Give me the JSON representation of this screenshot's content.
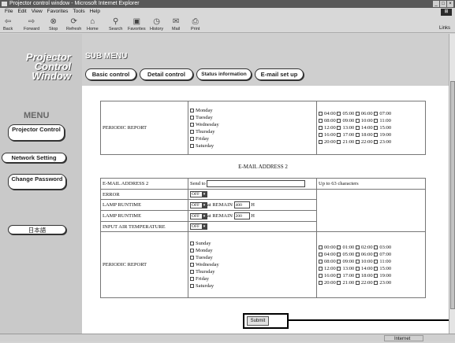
{
  "window": {
    "title": "Projector control window - Microsoft Internet Explorer"
  },
  "menubar": {
    "items": [
      "File",
      "Edit",
      "View",
      "Favorites",
      "Tools",
      "Help"
    ]
  },
  "toolbar": {
    "back": "Back",
    "forward": "Forward",
    "stop": "Stop",
    "refresh": "Refresh",
    "home": "Home",
    "search": "Search",
    "favorites": "Favorites",
    "history": "History",
    "mail": "Mail",
    "print": "Print",
    "links": "Links"
  },
  "sidebar": {
    "brand": [
      "Projector",
      "Control",
      "Window"
    ],
    "menu_title": "MENU",
    "buttons": [
      "Projector Control",
      "Network Setting",
      "Change Password",
      "日本語"
    ]
  },
  "header": {
    "submenu": "SUB MENU",
    "tabs": [
      "Basic control",
      "Detail control",
      "Status information",
      "E-mail set up"
    ]
  },
  "section1": {
    "label": "PERIODIC REPORT",
    "days": [
      "Monday",
      "Tuesday",
      "Wednesday",
      "Thursday",
      "Friday",
      "Saturday"
    ],
    "hours": [
      [
        "04:00",
        "05:00",
        "06:00",
        "07:00"
      ],
      [
        "08:00",
        "09:00",
        "10:00",
        "11:00"
      ],
      [
        "12:00",
        "13:00",
        "14:00",
        "15:00"
      ],
      [
        "16:00",
        "17:00",
        "18:00",
        "19:00"
      ],
      [
        "20:00",
        "21:00",
        "22:00",
        "23:00"
      ]
    ]
  },
  "section2": {
    "title": "E-MAIL ADDRESS 2",
    "email_label": "E-MAIL ADDRESS 2",
    "send_to": "Send to",
    "email_hint": "Up to 63 characters",
    "error_label": "ERROR",
    "error_val": "OFF",
    "lamp1_label": "LAMP RUNTIME",
    "lamp1_val": "OFF",
    "lamp1_at": "at REMAIN",
    "lamp1_num": "400",
    "lamp1_unit": "H",
    "lamp2_label": "LAMP RUNTIME",
    "lamp2_val": "OFF",
    "lamp2_at": "at REMAIN",
    "lamp2_num": "200",
    "lamp2_unit": "H",
    "temp_label": "INPUT AIR TEMPERATURE",
    "temp_val": "OFF",
    "periodic_label": "PERIODIC REPORT",
    "days": [
      "Sunday",
      "Monday",
      "Tuesday",
      "Wednesday",
      "Thursday",
      "Friday",
      "Saturday"
    ],
    "hours": [
      [
        "00:00",
        "01:00",
        "02:00",
        "03:00"
      ],
      [
        "04:00",
        "05:00",
        "06:00",
        "07:00"
      ],
      [
        "08:00",
        "09:00",
        "10:00",
        "11:00"
      ],
      [
        "12:00",
        "13:00",
        "14:00",
        "15:00"
      ],
      [
        "16:00",
        "17:00",
        "18:00",
        "19:00"
      ],
      [
        "20:00",
        "21:00",
        "22:00",
        "23:00"
      ]
    ]
  },
  "submit": {
    "label": "Submit"
  },
  "status": {
    "left": "",
    "zone": "Internet"
  }
}
